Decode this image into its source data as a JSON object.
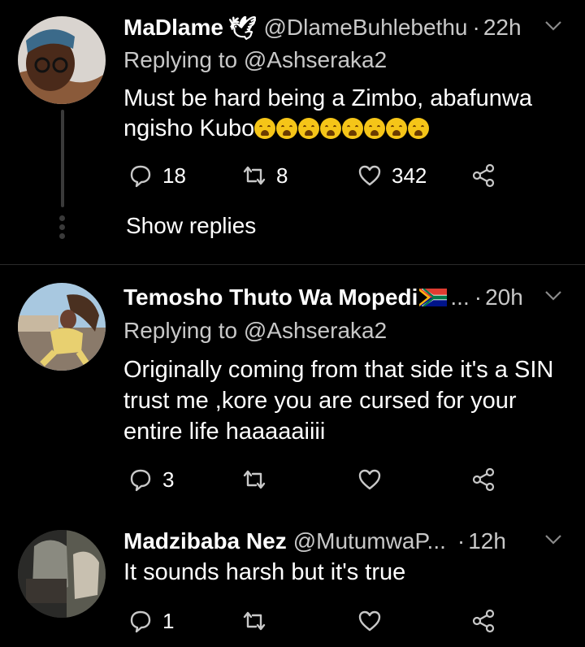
{
  "tweets": [
    {
      "name": "MaDlame",
      "name_suffix": "🕊",
      "handle": "@DlameBuhlebethu",
      "time": "22h",
      "replying_label": "Replying to",
      "replying_to": "@Ashseraka2",
      "text_line1": "Must be hard being a Zimbo, abafunwa",
      "text_line2": "ngisho Kubo",
      "emoji_count": 8,
      "replies": "18",
      "retweets": "8",
      "likes": "342",
      "show_replies": "Show replies"
    },
    {
      "name": "Temosho Thuto Wa Mopedi",
      "handle": "...",
      "time": "20h",
      "replying_label": "Replying to",
      "replying_to": "@Ashseraka2",
      "text": "Originally coming from that side it's a SIN trust me ,kore you are cursed for your entire life haaaaaiiii",
      "replies": "3",
      "retweets": "",
      "likes": ""
    },
    {
      "name": "Madzibaba Nez",
      "handle": "@MutumwaP...",
      "time": "12h",
      "text": "It sounds harsh but it's true",
      "replies": "1",
      "retweets": "",
      "likes": ""
    }
  ],
  "separator": "·",
  "colors": {
    "background": "#000000",
    "text": "#ffffff",
    "muted": "#c8c8c8",
    "divider": "#2a2a2a"
  }
}
